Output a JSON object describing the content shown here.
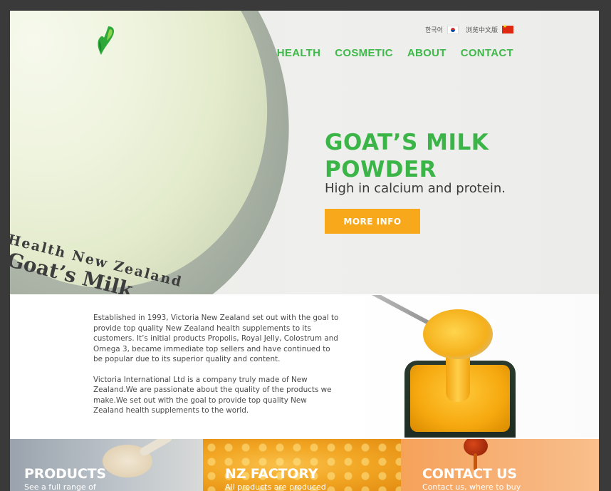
{
  "header": {
    "lang_korean": "한국어",
    "lang_chinese": "浏览中文版",
    "nav": [
      "HEALTH",
      "COSMETIC",
      "ABOUT",
      "CONTACT"
    ]
  },
  "hero": {
    "title_line1": "GOAT’S MILK",
    "title_line2": "POWDER",
    "subtitle": "High in calcium and protein.",
    "button": "MORE INFO",
    "can_label_line1": "Health New Zealand",
    "can_label_line2": "Goat’s Milk"
  },
  "about": {
    "paragraph1": "Established in 1993, Victoria New Zealand set out with the goal to provide top quality New Zealand health supplements to its customers. It’s initial products  Propolis, Royal Jelly, Colostrum and Omega 3, became immediate top sellers and have continued to be popular due to its superior quality and content.",
    "paragraph2": "Victoria International Ltd is a company truly made of New Zealand.We are passionate about the quality of the products we make.We set out with the goal to provide top quality New Zealand health supplements to the world."
  },
  "tiles": [
    {
      "title": "PRODUCTS",
      "text": "See a full range of"
    },
    {
      "title": "NZ FACTORY",
      "text": "All products are produced"
    },
    {
      "title": "CONTACT US",
      "text": "Contact us, where to buy"
    }
  ],
  "colors": {
    "brand_green": "#3cb548",
    "button_orange": "#f7a81b"
  },
  "icons": {
    "logo": "leaf-v-logo",
    "korea_flag": "korea-flag-icon",
    "china_flag": "china-flag-icon"
  }
}
